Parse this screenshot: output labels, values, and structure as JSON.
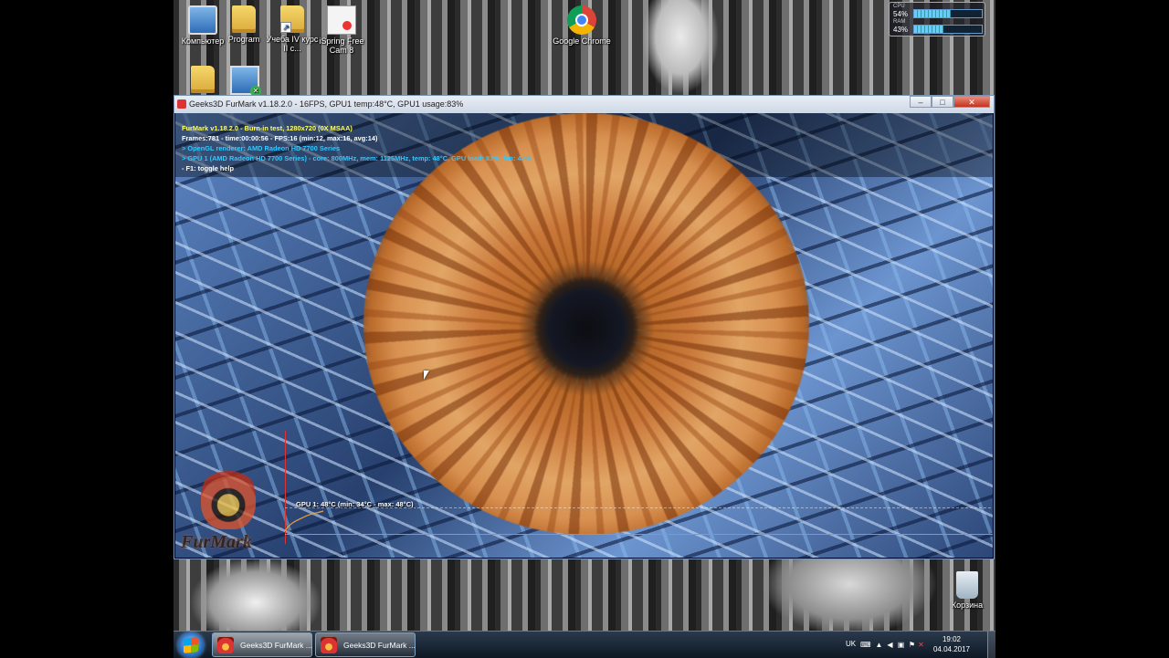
{
  "desktop": {
    "icons": [
      {
        "label": "Компьютер"
      },
      {
        "label": "Program"
      },
      {
        "label": "Учеба IV курс II с..."
      },
      {
        "label": "iSpring Free Cam 8"
      },
      {
        "label": "Google Chrome"
      },
      {
        "label": ""
      },
      {
        "label": ""
      }
    ],
    "recycle_bin": "Корзина"
  },
  "gadget": {
    "cpu_label": "CPU",
    "cpu_percent": "54%",
    "cpu_value": 54,
    "ram_label": "RAM",
    "ram_percent": "43%",
    "ram_value": 43
  },
  "window": {
    "title": "Geeks3D FurMark v1.18.2.0 - 16FPS, GPU1 temp:48°C, GPU1 usage:83%",
    "minimize": "–",
    "maximize": "□",
    "close": "✕"
  },
  "hud": {
    "line1": "FurMark v1.18.2.0 - Burn-in test, 1280x720 (0X MSAA)",
    "line2": "Frames:781 - time:00:00:56 - FPS:16 (min:12, max:16, avg:14)",
    "line3": "> OpenGL renderer: AMD Radeon HD 7700 Series",
    "line4": "> GPU 1 (AMD Radeon HD 7700 Series) - core: 800MHz, mem: 1125MHz, temp: 48°C, GPU load: 83%, fan: 42%",
    "line5": "- F1: toggle help",
    "colors": {
      "line1": "#ffff66",
      "line2": "#ffffff",
      "line3": "#33c8ff",
      "line4": "#33c8ff",
      "line5": "#ffffff"
    }
  },
  "graph": {
    "label": "GPU 1: 48°C (min: 34°C - max: 48°C)",
    "logo_text": "FurMark"
  },
  "taskbar": {
    "buttons": [
      {
        "label": "Geeks3D FurMark ..."
      },
      {
        "label": "Geeks3D FurMark ..."
      }
    ],
    "tray_lang": "UK",
    "time": "19:02",
    "date": "04.04.2017"
  }
}
